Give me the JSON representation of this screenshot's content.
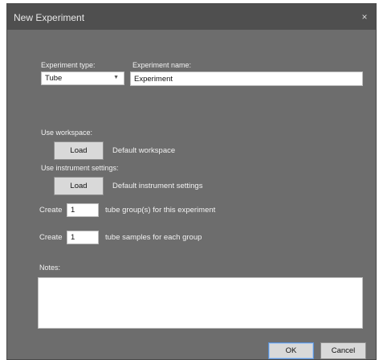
{
  "dialog": {
    "title": "New Experiment",
    "close_symbol": "×"
  },
  "experiment": {
    "type_label": "Experiment type:",
    "type_value": "Tube",
    "name_label": "Experiment name:",
    "name_value": "Experiment"
  },
  "workspace": {
    "label": "Use workspace:",
    "load_label": "Load",
    "default_text": "Default workspace"
  },
  "instrument": {
    "label": "Use instrument settings:",
    "load_label": "Load",
    "default_text": "Default instrument settings"
  },
  "tube_groups": {
    "create_label": "Create",
    "value": "1",
    "suffix": "tube group(s) for this experiment"
  },
  "tube_samples": {
    "create_label": "Create",
    "value": "1",
    "suffix": "tube samples for each group"
  },
  "notes": {
    "label": "Notes:",
    "value": ""
  },
  "footer": {
    "ok_label": "OK",
    "cancel_label": "Cancel"
  }
}
